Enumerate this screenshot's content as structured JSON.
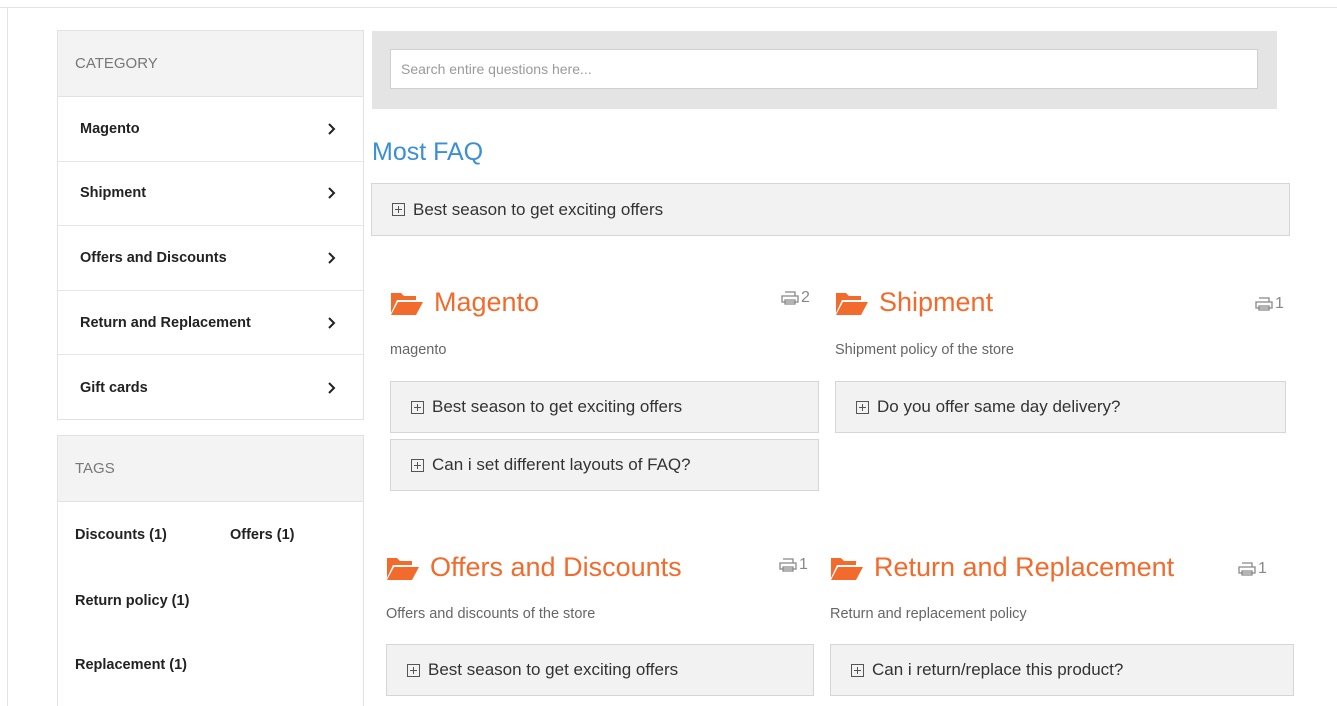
{
  "sidebar": {
    "category_heading": "CATEGORY",
    "categories": [
      {
        "label": "Magento"
      },
      {
        "label": "Shipment"
      },
      {
        "label": "Offers and Discounts"
      },
      {
        "label": "Return and Replacement"
      },
      {
        "label": "Gift cards"
      }
    ],
    "tags_heading": "TAGS",
    "tags": [
      "Discounts (1)",
      "Offers (1)",
      "Return policy (1)",
      "Replacement (1)"
    ]
  },
  "search": {
    "placeholder": "Search entire questions here...",
    "value": ""
  },
  "most_faq": {
    "title": "Most FAQ",
    "questions": [
      "Best season to get exciting offers"
    ]
  },
  "faq_categories": [
    {
      "title": "Magento",
      "count": "2",
      "description": "magento",
      "questions": [
        "Best season to get exciting offers",
        "Can i set different layouts of FAQ?"
      ]
    },
    {
      "title": "Shipment",
      "count": "1",
      "description": "Shipment policy of the store",
      "questions": [
        "Do you offer same day delivery?"
      ]
    },
    {
      "title": "Offers and Discounts",
      "count": "1",
      "description": "Offers and discounts of the store",
      "questions": [
        "Best season to get exciting offers"
      ]
    },
    {
      "title": "Return and Replacement",
      "count": "1",
      "description": "Return and replacement policy",
      "questions": [
        "Can i return/replace this product?"
      ]
    }
  ],
  "colors": {
    "category_title": "#f26b2c",
    "most_faq_title": "#3a8fd6",
    "panel_bg": "#f2f2f2",
    "search_bg": "#e4e4e4"
  },
  "icons": {
    "category_chevron": "chevron-right-icon",
    "question_toggle": "plus-square-icon",
    "category_folder": "folder-open-icon",
    "question_count": "print-icon"
  }
}
